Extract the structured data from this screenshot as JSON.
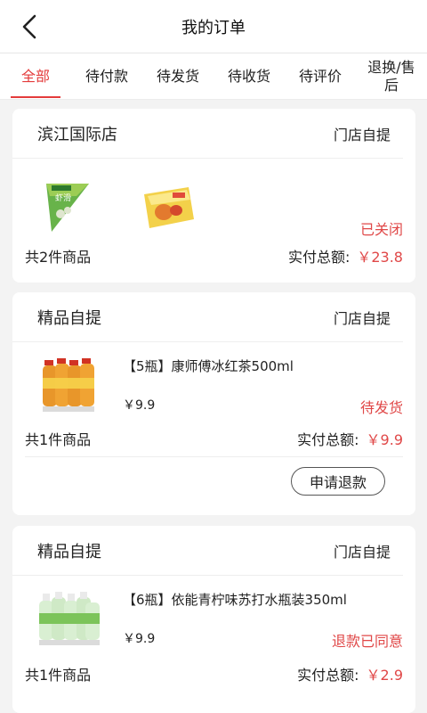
{
  "header": {
    "title": "我的订单"
  },
  "tabs": [
    {
      "label": "全部"
    },
    {
      "label": "待付款"
    },
    {
      "label": "待发货"
    },
    {
      "label": "待收货"
    },
    {
      "label": "待评价"
    },
    {
      "label": "退换/售后"
    }
  ],
  "orders": [
    {
      "store": "滨江国际店",
      "pickup": "门店自提",
      "status": "已关闭",
      "count_text": "共2件商品",
      "total_label": "实付总额:",
      "total": "￥23.8",
      "products": [
        {
          "icon": "triangle-snack-package-image"
        },
        {
          "icon": "bagged-bread-image"
        }
      ]
    },
    {
      "store": "精品自提",
      "pickup": "门店自提",
      "status": "待发货",
      "count_text": "共1件商品",
      "total_label": "实付总额:",
      "total": "￥9.9",
      "product_name": "【5瓶】康师傅冰红茶500ml",
      "unit_price": "￥9.9",
      "refund_button": "申请退款",
      "products": [
        {
          "icon": "ice-tea-bottles-image"
        }
      ]
    },
    {
      "store": "精品自提",
      "pickup": "门店自提",
      "status": "退款已同意",
      "count_text": "共1件商品",
      "total_label": "实付总额:",
      "total": "￥2.9",
      "product_name": "【6瓶】依能青柠味苏打水瓶装350ml",
      "unit_price": "￥9.9",
      "products": [
        {
          "icon": "soda-water-bottles-image"
        }
      ]
    }
  ],
  "colors": {
    "accent": "#e43b3b",
    "price": "#e04848"
  }
}
